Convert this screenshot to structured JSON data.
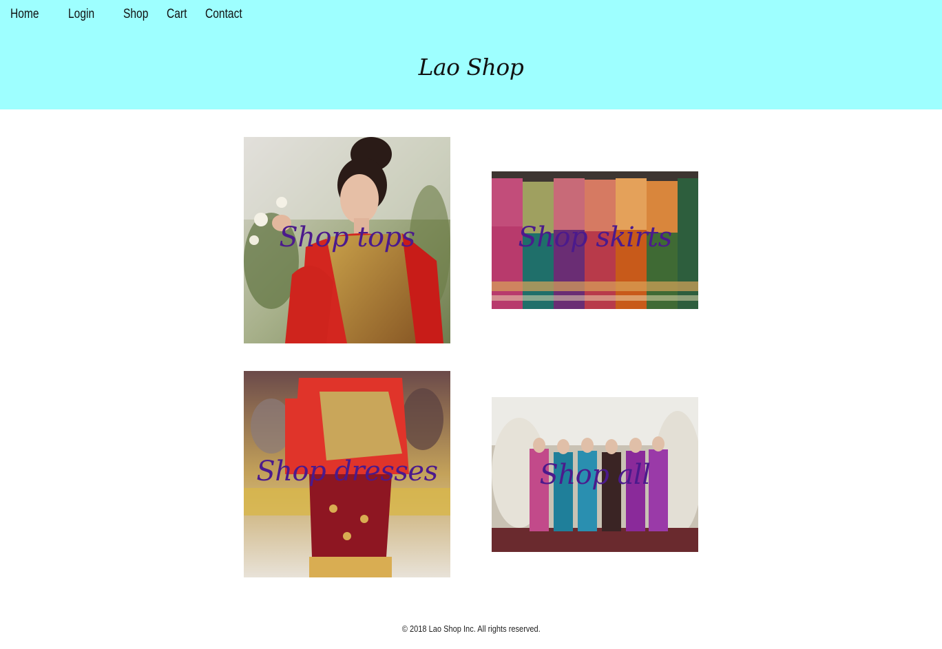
{
  "nav": {
    "items": [
      "Home",
      "Login",
      "Shop",
      "Cart",
      "Contact"
    ]
  },
  "header": {
    "title": "Lao Shop",
    "background": "#9effff"
  },
  "tiles": [
    {
      "label": "Shop tops",
      "image": "woman in red silk top with gold sash"
    },
    {
      "label": "Shop skirts",
      "image": "mannequins wearing woven sinh skirts"
    },
    {
      "label": "Shop dresses",
      "image": "model in red blouse and maroon embroidered skirt"
    },
    {
      "label": "Shop all",
      "image": "group of women in traditional Lao outfits"
    }
  ],
  "accent_color": "#4b1a8c",
  "footer": {
    "text": "© 2018 Lao Shop Inc. All rights reserved."
  }
}
